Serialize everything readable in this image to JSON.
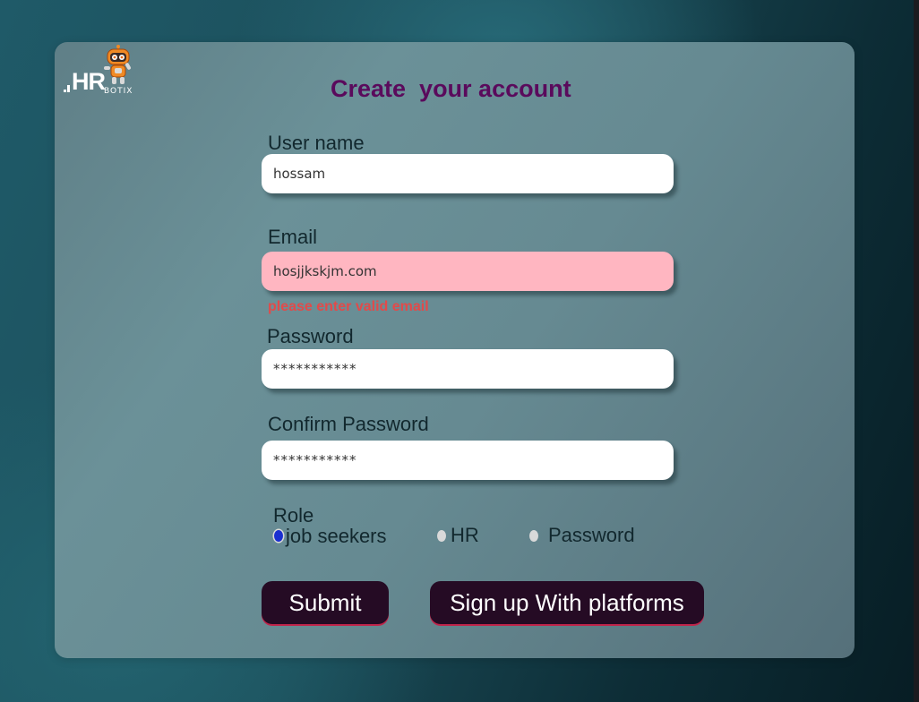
{
  "logo": {
    "hr_text": "HR",
    "botix_text": "BOTIX",
    "mascot_icon": "robot-mascot-icon"
  },
  "title": "Create  your account",
  "fields": {
    "username": {
      "label": "User name",
      "value": "hossam"
    },
    "email": {
      "label": "Email",
      "value": "hosjjkskjm.com",
      "error": "please enter valid email"
    },
    "password": {
      "label": "Password",
      "value": "***********"
    },
    "confirm_password": {
      "label": "Confirm Password",
      "value": "***********"
    }
  },
  "role": {
    "label": "Role",
    "options": [
      {
        "label": "job seekers",
        "checked": true
      },
      {
        "label": "HR",
        "checked": false
      },
      {
        "label": "Password",
        "checked": false
      }
    ]
  },
  "buttons": {
    "submit": "Submit",
    "sign_up_platforms": "Sign up With platforms"
  },
  "colors": {
    "title": "#5a0a5c",
    "button_bg": "#250b24",
    "error_text": "#e24a4a",
    "invalid_field_bg": "#ffb6c1",
    "radio_checked": "#1a2fd0"
  }
}
